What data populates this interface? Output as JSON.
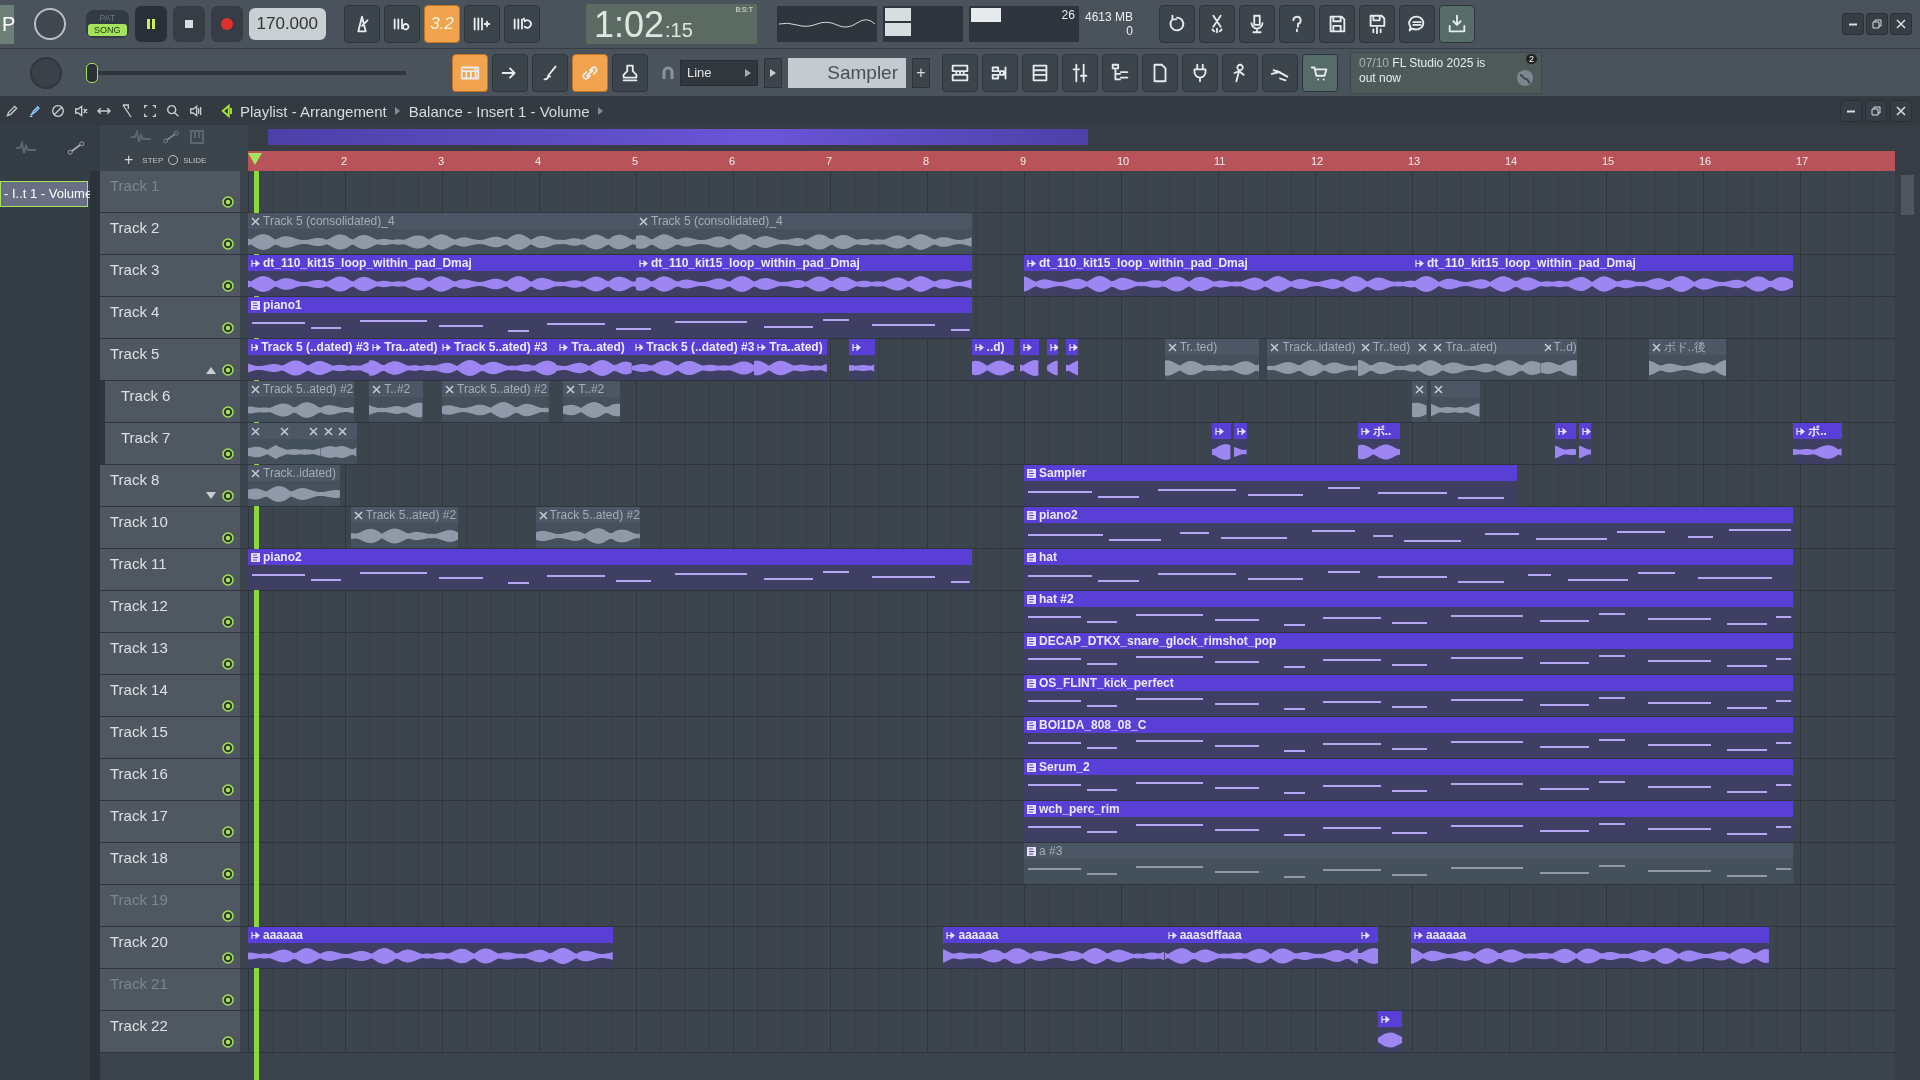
{
  "top_toolbar": {
    "edge_label": "P",
    "mode": [
      {
        "label": "PAT",
        "selected": false
      },
      {
        "label": "SONG",
        "selected": true
      }
    ],
    "transport": [
      {
        "kind": "pause",
        "on": true
      },
      {
        "kind": "stop",
        "on": false
      },
      {
        "kind": "record",
        "on": false
      }
    ],
    "tempo": "170.000",
    "record_buttons": [
      {
        "kind": "metronome",
        "on": false
      },
      {
        "kind": "wait",
        "on": false
      },
      {
        "kind": "typing",
        "label": "3.2",
        "on": true
      },
      {
        "kind": "step",
        "on": false
      },
      {
        "kind": "loop",
        "on": false
      }
    ],
    "time": {
      "main": "1:02",
      "sub": ":15",
      "format": "B:S:T"
    },
    "cpu": "26",
    "memory": "4613 MB",
    "polyphony": "0",
    "tool_buttons": [
      {
        "kind": "undo",
        "on": false
      },
      {
        "kind": "cut",
        "on": false
      },
      {
        "kind": "mic",
        "on": false
      },
      {
        "kind": "help",
        "on": false
      },
      {
        "kind": "save",
        "on": false
      },
      {
        "kind": "render",
        "on": false
      },
      {
        "kind": "chat",
        "on": false
      },
      {
        "kind": "download",
        "on": true
      }
    ],
    "master_pitch": {
      "level": 0
    },
    "snap_buttons": [
      {
        "kind": "playlist",
        "on": true
      },
      {
        "kind": "arrow",
        "on": false
      },
      {
        "kind": "brush",
        "on": false
      },
      {
        "kind": "link",
        "on": true
      },
      {
        "kind": "stamp",
        "on": false
      }
    ],
    "snap": "Line",
    "pattern": "Sampler",
    "add": "+",
    "view_buttons": [
      {
        "kind": "piano",
        "on": false
      },
      {
        "kind": "steps",
        "on": false
      },
      {
        "kind": "channels",
        "on": false
      },
      {
        "kind": "mixer",
        "on": false
      },
      {
        "kind": "browser",
        "on": false
      },
      {
        "kind": "clipboard",
        "on": false
      },
      {
        "kind": "plugin",
        "on": false
      },
      {
        "kind": "person",
        "on": false
      },
      {
        "kind": "hand",
        "on": false
      },
      {
        "kind": "cart",
        "on": true
      }
    ],
    "news": {
      "date": "07/10",
      "text": "FL Studio 2025 is out now",
      "count": "2"
    }
  },
  "playlist": {
    "tools": [
      {
        "kind": "pencil",
        "on": false
      },
      {
        "kind": "paint",
        "on": true
      },
      {
        "kind": "delete",
        "on": false
      },
      {
        "kind": "mute",
        "on": false
      },
      {
        "kind": "slip",
        "on": false
      },
      {
        "kind": "slice",
        "on": false
      },
      {
        "kind": "select",
        "on": false
      },
      {
        "kind": "zoom",
        "on": false
      },
      {
        "kind": "speaker",
        "on": false
      }
    ],
    "title": "Playlist - Arrangement",
    "breadcrumb": "Balance - Insert 1 - Volume",
    "clip_source": {
      "label": "- I..t 1 - Volume",
      "selected": true
    },
    "header_controls": {
      "step": "STEP",
      "slide": "SLIDE",
      "add": "+"
    },
    "ruler": [
      "2",
      "3",
      "4",
      "5",
      "6",
      "7",
      "8",
      "9",
      "10",
      "11",
      "12",
      "13",
      "14",
      "15",
      "16",
      "17"
    ],
    "tracks": [
      {
        "name": "Track 1",
        "enabled": false
      },
      {
        "name": "Track 2",
        "enabled": true,
        "clips": [
          {
            "label": "Track 5 (consolidated)_4",
            "kind": "audio",
            "muted": true
          },
          {
            "label": "Track 5 (consolidated)_4",
            "kind": "audio",
            "muted": true
          }
        ]
      },
      {
        "name": "Track 3",
        "enabled": true,
        "clips": [
          {
            "label": "dt_110_kit15_loop_within_pad_Dmaj",
            "kind": "audio",
            "muted": false
          },
          {
            "label": "dt_110_kit15_loop_within_pad_Dmaj",
            "kind": "audio",
            "muted": false
          },
          {
            "label": "dt_110_kit15_loop_within_pad_Dmaj",
            "kind": "audio",
            "muted": false
          },
          {
            "label": "dt_110_kit15_loop_within_pad_Dmaj",
            "kind": "audio",
            "muted": false
          }
        ]
      },
      {
        "name": "Track 4",
        "enabled": true,
        "clips": [
          {
            "label": "piano1",
            "kind": "pattern",
            "muted": false
          }
        ]
      },
      {
        "name": "Track 5",
        "enabled": true,
        "expanded": true,
        "clips": [
          {
            "label": "Track 5 (..dated) #3",
            "kind": "audio",
            "muted": false
          },
          {
            "label": "Tra..ated)",
            "kind": "audio",
            "muted": false
          },
          {
            "label": "Track 5..ated) #3",
            "kind": "audio",
            "muted": false
          },
          {
            "label": "Tra..ated)",
            "kind": "audio",
            "muted": false
          },
          {
            "label": "Track 5 (..dated) #3",
            "kind": "audio",
            "muted": false
          },
          {
            "label": "Tra..ated)",
            "kind": "audio",
            "muted": false
          },
          {
            "kind": "audio",
            "muted": false
          },
          {
            "label": "..d)",
            "kind": "audio",
            "muted": false
          },
          {
            "kind": "audio",
            "muted": false
          },
          {
            "kind": "audio",
            "muted": false
          },
          {
            "kind": "audio",
            "muted": false
          },
          {
            "label": "Tr..ted)",
            "kind": "audio",
            "muted": true
          },
          {
            "label": "Track..idated)",
            "kind": "audio",
            "muted": true
          },
          {
            "label": "Tr..ted)",
            "kind": "audio",
            "muted": true
          },
          {
            "kind": "audio",
            "muted": true
          },
          {
            "label": "Tra..ated)",
            "kind": "audio",
            "muted": true
          },
          {
            "label": "T..d)",
            "kind": "audio",
            "muted": true
          },
          {
            "label": "ボド..後",
            "kind": "audio",
            "muted": true
          }
        ],
        "children": [
          {
            "name": "Track 6",
            "enabled": true,
            "clips": [
              {
                "label": "Track 5..ated) #2",
                "kind": "audio",
                "muted": true
              },
              {
                "label": "T..#2",
                "kind": "audio",
                "muted": true
              },
              {
                "label": "Track 5..ated) #2",
                "kind": "audio",
                "muted": true
              },
              {
                "label": "T..#2",
                "kind": "audio",
                "muted": true
              },
              {
                "kind": "audio",
                "muted": true
              },
              {
                "kind": "audio",
                "muted": true
              }
            ]
          },
          {
            "name": "Track 7",
            "enabled": true,
            "clips": [
              {
                "kind": "audio",
                "muted": true
              },
              {
                "kind": "audio",
                "muted": true
              },
              {
                "kind": "audio",
                "muted": true
              },
              {
                "kind": "audio",
                "muted": true
              },
              {
                "kind": "audio",
                "muted": true
              },
              {
                "kind": "audio",
                "muted": false
              },
              {
                "kind": "audio",
                "muted": false
              },
              {
                "label": "ボ..",
                "kind": "audio",
                "muted": false
              },
              {
                "kind": "audio",
                "muted": false
              },
              {
                "kind": "audio",
                "muted": false
              },
              {
                "label": "ボ..",
                "kind": "audio",
                "muted": false
              }
            ]
          }
        ]
      },
      {
        "name": "Track 8",
        "enabled": true,
        "expanded": false,
        "clips": [
          {
            "label": "Track..idated)",
            "kind": "audio",
            "muted": true
          },
          {
            "label": "Sampler",
            "kind": "pattern",
            "muted": false
          }
        ]
      },
      {
        "name": "Track 10",
        "enabled": true,
        "clips": [
          {
            "label": "Track 5..ated) #2",
            "kind": "audio",
            "muted": true
          },
          {
            "label": "Track 5..ated) #2",
            "kind": "audio",
            "muted": true
          },
          {
            "label": "piano2",
            "kind": "pattern",
            "muted": false
          }
        ]
      },
      {
        "name": "Track 11",
        "enabled": true,
        "clips": [
          {
            "label": "piano2",
            "kind": "pattern",
            "muted": false
          },
          {
            "label": "hat",
            "kind": "pattern",
            "muted": false
          }
        ]
      },
      {
        "name": "Track 12",
        "enabled": true,
        "clips": [
          {
            "label": "hat #2",
            "kind": "pattern",
            "muted": false
          }
        ]
      },
      {
        "name": "Track 13",
        "enabled": true,
        "clips": [
          {
            "label": "DECAP_DTKX_snare_glock_rimshot_pop",
            "kind": "pattern",
            "muted": false
          }
        ]
      },
      {
        "name": "Track 14",
        "enabled": true,
        "clips": [
          {
            "label": "OS_FLINT_kick_perfect",
            "kind": "pattern",
            "muted": false
          }
        ]
      },
      {
        "name": "Track 15",
        "enabled": true,
        "clips": [
          {
            "label": "BOI1DA_808_08_C",
            "kind": "pattern",
            "muted": false
          }
        ]
      },
      {
        "name": "Track 16",
        "enabled": true,
        "clips": [
          {
            "label": "Serum_2",
            "kind": "pattern",
            "muted": false
          }
        ]
      },
      {
        "name": "Track 17",
        "enabled": true,
        "clips": [
          {
            "label": "wch_perc_rim",
            "kind": "pattern",
            "muted": false
          }
        ]
      },
      {
        "name": "Track 18",
        "enabled": true,
        "clips": [
          {
            "label": "a #3",
            "kind": "pattern",
            "muted": true
          }
        ]
      },
      {
        "name": "Track 19",
        "enabled": false
      },
      {
        "name": "Track 20",
        "enabled": true,
        "clips": [
          {
            "label": "aaaaaa",
            "kind": "audio",
            "muted": false
          },
          {
            "label": "aaaaaa",
            "kind": "audio",
            "muted": false
          },
          {
            "label": "aaasdffaaa",
            "kind": "audio",
            "muted": false
          },
          {
            "kind": "audio",
            "muted": false
          },
          {
            "label": "aaaaaa",
            "kind": "audio",
            "muted": false
          }
        ]
      },
      {
        "name": "Track 21",
        "enabled": false
      },
      {
        "name": "Track 22",
        "enabled": true,
        "clips": [
          {
            "kind": "audio",
            "muted": false
          }
        ]
      }
    ]
  }
}
